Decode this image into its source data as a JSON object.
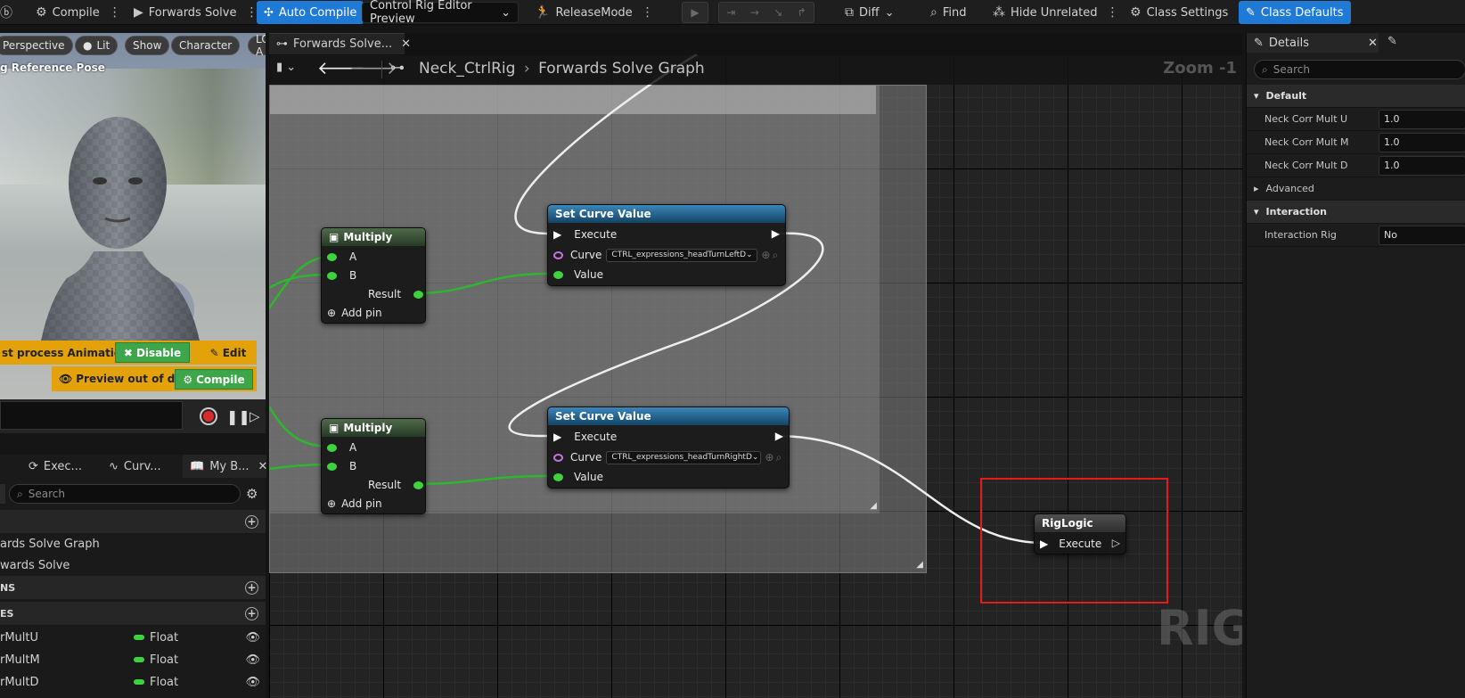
{
  "toolbar": {
    "compile": "Compile",
    "forwards_solve": "Forwards Solve",
    "auto_compile": "Auto Compile",
    "preview_dropdown": "Control Rig Editor Preview",
    "release_mode": "ReleaseMode",
    "diff": "Diff",
    "find": "Find",
    "hide_unrelated": "Hide Unrelated",
    "class_settings": "Class Settings",
    "class_defaults": "Class Defaults"
  },
  "viewport": {
    "perspective": "Perspective",
    "lit": "Lit",
    "show": "Show",
    "character": "Character",
    "lod": "LOD A",
    "caption": "g Reference Pose",
    "warning_text": "st process Animation E",
    "disable": "Disable",
    "edit": "Edit",
    "preview_out_of_date": "Preview out of date",
    "compile": "Compile"
  },
  "left_panel": {
    "tabs": [
      "Exec...",
      "Curv...",
      "My B..."
    ],
    "search_placeholder": "Search",
    "graphs": [
      "ards Solve Graph",
      "wards Solve"
    ],
    "section_functions": "NS",
    "section_variables": "ES",
    "variables": [
      {
        "name": "rMultU",
        "type": "Float"
      },
      {
        "name": "rMultM",
        "type": "Float"
      },
      {
        "name": "rMultD",
        "type": "Float"
      }
    ]
  },
  "graph": {
    "tab_label": "Forwards Solve...",
    "breadcrumb_root": "Neck_CtrlRig",
    "breadcrumb_leaf": "Forwards Solve Graph",
    "zoom": "Zoom -1",
    "watermark": "RIG",
    "nodes": {
      "multiply1": {
        "title": "Multiply",
        "a": "A",
        "b": "B",
        "result": "Result",
        "add_pin": "Add pin"
      },
      "multiply2": {
        "title": "Multiply",
        "a": "A",
        "b": "B",
        "result": "Result",
        "add_pin": "Add pin"
      },
      "setcurve1": {
        "title": "Set Curve Value",
        "execute": "Execute",
        "curve_label": "Curve",
        "curve_value": "CTRL_expressions_headTurnLeftD",
        "value": "Value"
      },
      "setcurve2": {
        "title": "Set Curve Value",
        "execute": "Execute",
        "curve_label": "Curve",
        "curve_value": "CTRL_expressions_headTurnRightD",
        "value": "Value"
      },
      "riglogic": {
        "title": "RigLogic",
        "execute": "Execute"
      }
    }
  },
  "details": {
    "tab": "Details",
    "search_placeholder": "Search",
    "cat_default": "Default",
    "props": [
      {
        "label": "Neck Corr Mult U",
        "value": "1.0"
      },
      {
        "label": "Neck Corr Mult M",
        "value": "1.0"
      },
      {
        "label": "Neck Corr Mult D",
        "value": "1.0"
      }
    ],
    "cat_advanced": "Advanced",
    "cat_interaction": "Interaction",
    "interaction_rig_label": "Interaction Rig",
    "interaction_rig_value": "No"
  },
  "colors": {
    "accent_blue": "#1f7ad6",
    "warning": "#e3a20a",
    "pin_green": "#3fd23f",
    "highlight_red": "#e31b1b"
  }
}
